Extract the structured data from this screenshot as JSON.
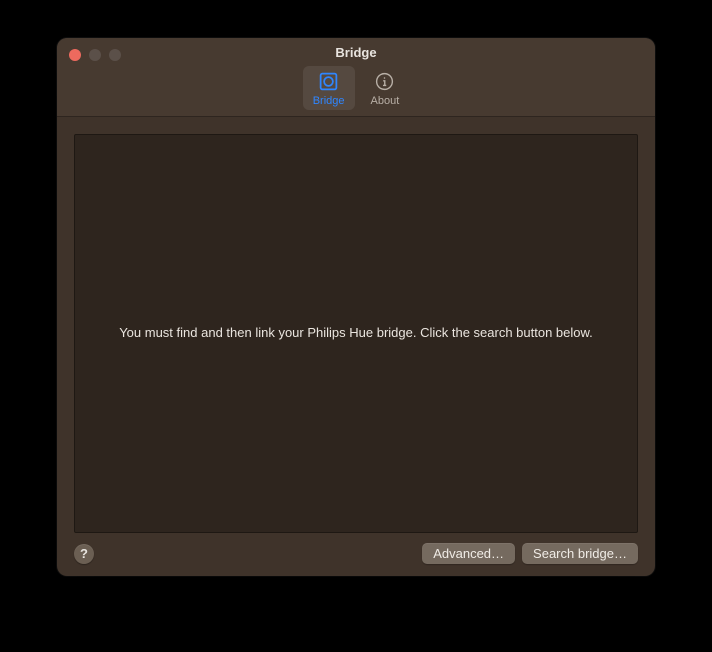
{
  "window": {
    "title": "Bridge"
  },
  "tabs": {
    "bridge": {
      "label": "Bridge"
    },
    "about": {
      "label": "About"
    }
  },
  "content": {
    "message": "You must find and then link your Philips Hue bridge. Click the search button below."
  },
  "footer": {
    "help": "?",
    "advanced_label": "Advanced…",
    "search_label": "Search bridge…"
  },
  "colors": {
    "window_bg": "#3f332a",
    "titlebar_bg": "#473a30",
    "panel_bg": "#2e251e",
    "accent": "#2f86ff"
  }
}
